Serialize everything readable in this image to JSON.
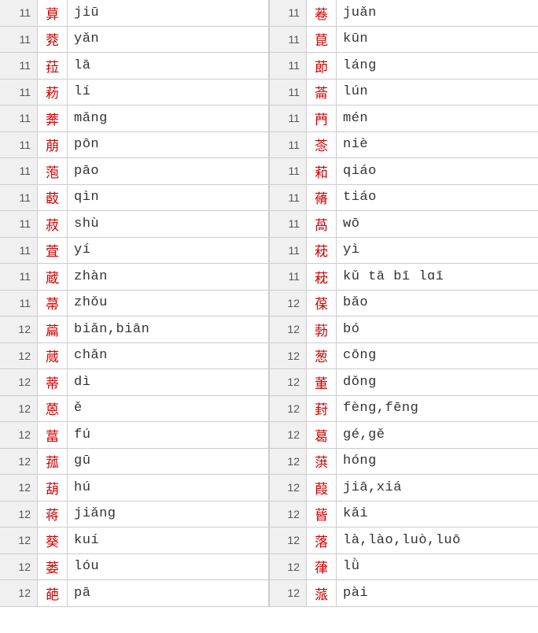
{
  "left": [
    {
      "strokes": "11",
      "char": "萛",
      "pinyin": "jiū"
    },
    {
      "strokes": "11",
      "char": "萒",
      "pinyin": "yǎn"
    },
    {
      "strokes": "11",
      "char": "菈",
      "pinyin": "lā"
    },
    {
      "strokes": "11",
      "char": "菞",
      "pinyin": "lí"
    },
    {
      "strokes": "11",
      "char": "莾",
      "pinyin": "mǎng"
    },
    {
      "strokes": "11",
      "char": "萠",
      "pinyin": "pōn"
    },
    {
      "strokes": "11",
      "char": "萢",
      "pinyin": "pāo"
    },
    {
      "strokes": "11",
      "char": "菣",
      "pinyin": "qìn"
    },
    {
      "strokes": "11",
      "char": "菽",
      "pinyin": "shù"
    },
    {
      "strokes": "11",
      "char": "萓",
      "pinyin": "yí"
    },
    {
      "strokes": "11",
      "char": "蔵",
      "pinyin": "zhàn"
    },
    {
      "strokes": "11",
      "char": "菷",
      "pinyin": "zhǒu"
    },
    {
      "strokes": "12",
      "char": "萹",
      "pinyin": "biǎn,biān"
    },
    {
      "strokes": "12",
      "char": "蒇",
      "pinyin": "chǎn"
    },
    {
      "strokes": "12",
      "char": "蒂",
      "pinyin": "dì"
    },
    {
      "strokes": "12",
      "char": "蒽",
      "pinyin": "ě"
    },
    {
      "strokes": "12",
      "char": "葍",
      "pinyin": "fú"
    },
    {
      "strokes": "12",
      "char": "菰",
      "pinyin": "gū"
    },
    {
      "strokes": "12",
      "char": "葫",
      "pinyin": "hú"
    },
    {
      "strokes": "12",
      "char": "蒋",
      "pinyin": "jiǎng"
    },
    {
      "strokes": "12",
      "char": "葵",
      "pinyin": "kuí"
    },
    {
      "strokes": "12",
      "char": "蒌",
      "pinyin": "lóu"
    },
    {
      "strokes": "12",
      "char": "葩",
      "pinyin": "pā"
    }
  ],
  "right": [
    {
      "strokes": "11",
      "char": "菤",
      "pinyin": "juǎn"
    },
    {
      "strokes": "11",
      "char": "菎",
      "pinyin": "kūn"
    },
    {
      "strokes": "11",
      "char": "莭",
      "pinyin": "láng"
    },
    {
      "strokes": "11",
      "char": "菕",
      "pinyin": "lún"
    },
    {
      "strokes": "11",
      "char": "菛",
      "pinyin": "mén"
    },
    {
      "strokes": "11",
      "char": "菍",
      "pinyin": "niè"
    },
    {
      "strokes": "11",
      "char": "萂",
      "pinyin": "qiáo"
    },
    {
      "strokes": "11",
      "char": "蓨",
      "pinyin": "tiáo"
    },
    {
      "strokes": "11",
      "char": "萵",
      "pinyin": "wō"
    },
    {
      "strokes": "11",
      "char": "萙",
      "pinyin": "yì"
    },
    {
      "strokes": "11",
      "char": "萙",
      "pinyin": "kǔ tā bī lɑī"
    },
    {
      "strokes": "12",
      "char": "葆",
      "pinyin": "bǎo"
    },
    {
      "strokes": "12",
      "char": "葧",
      "pinyin": "bó"
    },
    {
      "strokes": "12",
      "char": "葱",
      "pinyin": "cōng"
    },
    {
      "strokes": "12",
      "char": "董",
      "pinyin": "dǒng"
    },
    {
      "strokes": "12",
      "char": "葑",
      "pinyin": "fèng,fēng"
    },
    {
      "strokes": "12",
      "char": "葛",
      "pinyin": "gé,gě"
    },
    {
      "strokes": "12",
      "char": "葓",
      "pinyin": "hóng"
    },
    {
      "strokes": "12",
      "char": "葭",
      "pinyin": "jiā,xiá"
    },
    {
      "strokes": "12",
      "char": "蒈",
      "pinyin": "kǎi"
    },
    {
      "strokes": "12",
      "char": "落",
      "pinyin": "là,lào,luò,luō"
    },
    {
      "strokes": "12",
      "char": "葎",
      "pinyin": "lǜ"
    },
    {
      "strokes": "12",
      "char": "蒎",
      "pinyin": "pài"
    }
  ]
}
